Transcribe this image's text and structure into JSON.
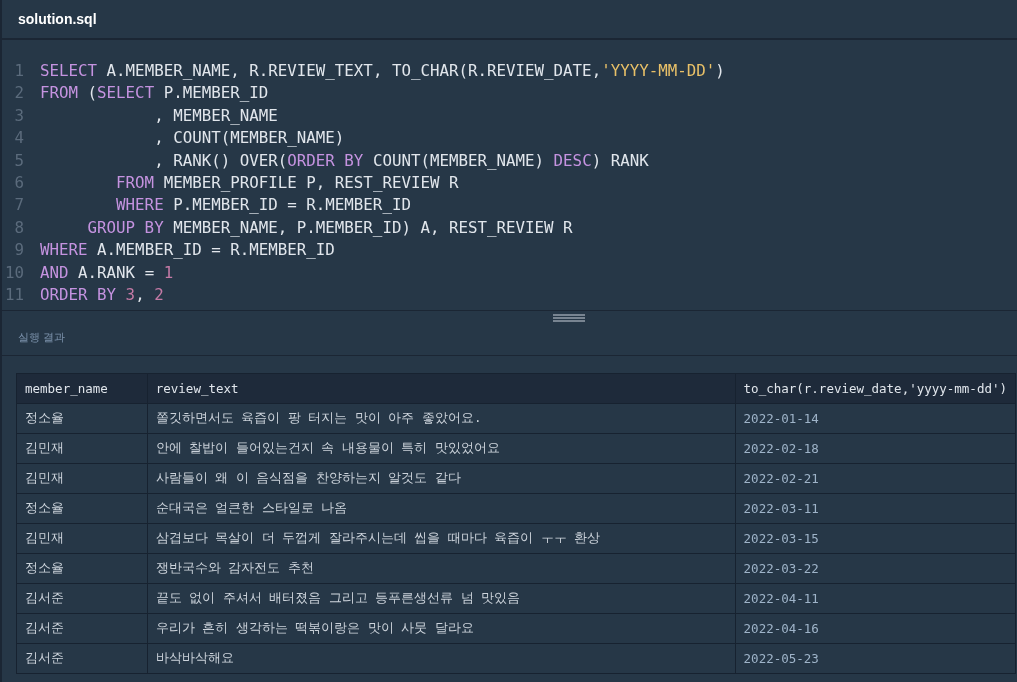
{
  "file_tab": {
    "title": "solution.sql"
  },
  "editor": {
    "lines": [
      {
        "number": "1",
        "tokens": [
          {
            "kind": "kw",
            "text": "SELECT"
          },
          {
            "kind": "plain",
            "text": " A.MEMBER_NAME, R.REVIEW_TEXT, TO_CHAR(R.REVIEW_DATE,"
          },
          {
            "kind": "str",
            "text": "'YYYY-MM-DD'"
          },
          {
            "kind": "plain",
            "text": ")"
          }
        ]
      },
      {
        "number": "2",
        "tokens": [
          {
            "kind": "kw",
            "text": "FROM"
          },
          {
            "kind": "plain",
            "text": " ("
          },
          {
            "kind": "kw",
            "text": "SELECT"
          },
          {
            "kind": "plain",
            "text": " P.MEMBER_ID"
          }
        ]
      },
      {
        "number": "3",
        "tokens": [
          {
            "kind": "plain",
            "text": "            , MEMBER_NAME"
          }
        ]
      },
      {
        "number": "4",
        "tokens": [
          {
            "kind": "plain",
            "text": "            , COUNT(MEMBER_NAME)"
          }
        ]
      },
      {
        "number": "5",
        "tokens": [
          {
            "kind": "plain",
            "text": "            , RANK() OVER("
          },
          {
            "kind": "kw",
            "text": "ORDER BY"
          },
          {
            "kind": "plain",
            "text": " COUNT(MEMBER_NAME) "
          },
          {
            "kind": "kw",
            "text": "DESC"
          },
          {
            "kind": "plain",
            "text": ") RANK"
          }
        ]
      },
      {
        "number": "6",
        "tokens": [
          {
            "kind": "kw",
            "text": "        FROM"
          },
          {
            "kind": "plain",
            "text": " MEMBER_PROFILE P, REST_REVIEW R"
          }
        ]
      },
      {
        "number": "7",
        "tokens": [
          {
            "kind": "kw",
            "text": "        WHERE"
          },
          {
            "kind": "plain",
            "text": " P.MEMBER_ID = R.MEMBER_ID"
          }
        ]
      },
      {
        "number": "8",
        "tokens": [
          {
            "kind": "kw",
            "text": "     GROUP BY"
          },
          {
            "kind": "plain",
            "text": " MEMBER_NAME, P.MEMBER_ID) A, REST_REVIEW R"
          }
        ]
      },
      {
        "number": "9",
        "tokens": [
          {
            "kind": "kw",
            "text": "WHERE"
          },
          {
            "kind": "plain",
            "text": " A.MEMBER_ID = R.MEMBER_ID"
          }
        ]
      },
      {
        "number": "10",
        "tokens": [
          {
            "kind": "kw",
            "text": "AND"
          },
          {
            "kind": "plain",
            "text": " A.RANK = "
          },
          {
            "kind": "num",
            "text": "1"
          }
        ]
      },
      {
        "number": "11",
        "tokens": [
          {
            "kind": "kw",
            "text": "ORDER BY "
          },
          {
            "kind": "num",
            "text": "3"
          },
          {
            "kind": "plain",
            "text": ", "
          },
          {
            "kind": "num",
            "text": "2"
          }
        ]
      }
    ]
  },
  "results": {
    "title": "실행 결과",
    "table": {
      "columns": [
        "member_name",
        "review_text",
        "to_char(r.review_date,'yyyy-mm-dd')"
      ],
      "rows": [
        [
          "정소율",
          "쫄깃하면서도 육즙이 팡 터지는 맛이 아주 좋았어요.",
          "2022-01-14"
        ],
        [
          "김민재",
          "안에 찰밥이 들어있는건지 속 내용물이 특히 맛있었어요",
          "2022-02-18"
        ],
        [
          "김민재",
          "사람들이 왜 이 음식점을 찬양하는지 알것도 같다",
          "2022-02-21"
        ],
        [
          "정소율",
          "순대국은 얼큰한 스타일로 나옴",
          "2022-03-11"
        ],
        [
          "김민재",
          "삼겹보다 목살이 더 두껍게 잘라주시는데 씹을 때마다 육즙이 ㅜㅜ 환상",
          "2022-03-15"
        ],
        [
          "정소율",
          "쟁반국수와 감자전도 추천",
          "2022-03-22"
        ],
        [
          "김서준",
          "끝도 없이 주셔서 배터졌음 그리고 등푸른생선류 넘 맛있음",
          "2022-04-11"
        ],
        [
          "김서준",
          "우리가 흔히 생각하는 떡볶이랑은 맛이 사뭇 달라요",
          "2022-04-16"
        ],
        [
          "김서준",
          "바삭바삭해요",
          "2022-05-23"
        ]
      ]
    }
  }
}
